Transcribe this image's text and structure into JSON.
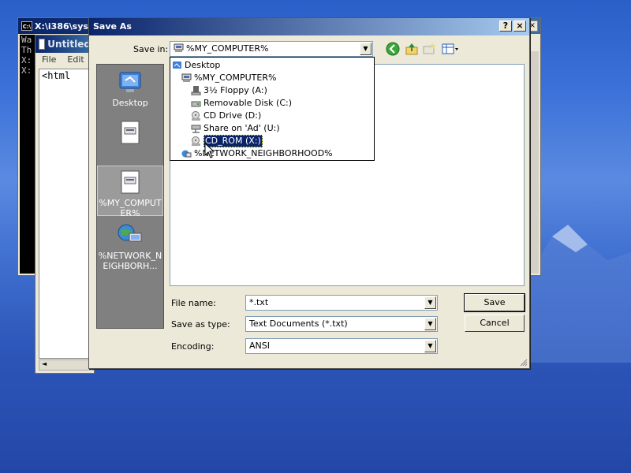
{
  "console": {
    "title": "X:\\i386\\sys",
    "icon_text": "C:\\",
    "lines": [
      "Wa",
      "Th",
      "",
      "X:",
      "",
      "X:"
    ],
    "close_glyph": "×"
  },
  "notepad": {
    "title": "Untitled",
    "menu": [
      "File",
      "Edit"
    ],
    "content": "<html",
    "scroll_glyph": "◄"
  },
  "dialog": {
    "title": "Save As",
    "help_glyph": "?",
    "close_glyph": "×",
    "save_in_label": "Save in:",
    "save_in_value": "%MY_COMPUTER%",
    "places": [
      {
        "label": "Desktop",
        "icon": "desktop-icon"
      },
      {
        "label": "",
        "icon": "document-icon"
      },
      {
        "label": "%MY_COMPUTER%",
        "icon": "my-computer-icon"
      },
      {
        "label": "%NETWORK_NEIGHBORH...",
        "icon": "network-icon"
      }
    ],
    "dropdown_items": [
      {
        "label": "Desktop",
        "icon": "desktop-icon"
      },
      {
        "label": "%MY_COMPUTER%",
        "icon": "computer-icon"
      },
      {
        "label": "3½ Floppy (A:)",
        "icon": "floppy-icon"
      },
      {
        "label": "Removable Disk (C:)",
        "icon": "removable-disk-icon"
      },
      {
        "label": "CD Drive (D:)",
        "icon": "cd-drive-icon"
      },
      {
        "label": "Share on 'Ad' (U:)",
        "icon": "network-share-icon"
      },
      {
        "label": "CD_ROM (X:)",
        "icon": "cd-rom-icon"
      },
      {
        "label": "%NETWORK_NEIGHBORHOOD%",
        "icon": "network-icon"
      }
    ],
    "file_name_label": "File name:",
    "file_name_value": "*.txt",
    "save_as_type_label": "Save as type:",
    "save_as_type_value": "Text Documents (*.txt)",
    "encoding_label": "Encoding:",
    "encoding_value": "ANSI",
    "save_button": "Save",
    "cancel_button": "Cancel",
    "arrow_glyph": "▼"
  }
}
